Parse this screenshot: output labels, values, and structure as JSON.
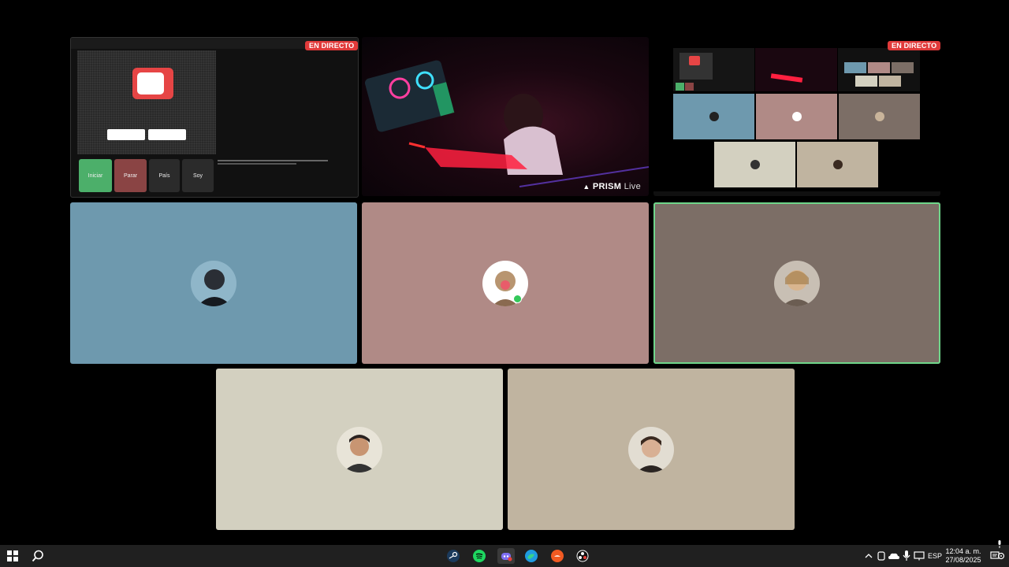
{
  "live_label": "EN DIRECTO",
  "share": {
    "buttons": [
      {
        "label": "Iniciar",
        "color": "#4caf6a"
      },
      {
        "label": "Parar",
        "color": "#8a4444"
      },
      {
        "label": "País",
        "color": "#2b2b2b"
      },
      {
        "label": "Soy",
        "color": "#2b2b2b"
      }
    ]
  },
  "cam": {
    "brand": "PRISM",
    "brand_suffix": "Live"
  },
  "participants": [
    {
      "id": "p1",
      "bg": "#6e99ae",
      "speaking": false,
      "online": false
    },
    {
      "id": "p2",
      "bg": "#b08a86",
      "speaking": false,
      "online": true
    },
    {
      "id": "p3",
      "bg": "#7c6e66",
      "speaking": true,
      "online": false
    },
    {
      "id": "p4",
      "bg": "#d3d0c0",
      "speaking": false,
      "online": false
    },
    {
      "id": "p5",
      "bg": "#c0b4a0",
      "speaking": false,
      "online": false
    }
  ],
  "taskbar": {
    "apps": [
      "windows-start",
      "search",
      "steam",
      "spotify",
      "discord",
      "edge",
      "brave",
      "obs"
    ],
    "language": "ESP",
    "time": "12:04 a. m.",
    "date": "27/08/2025"
  }
}
